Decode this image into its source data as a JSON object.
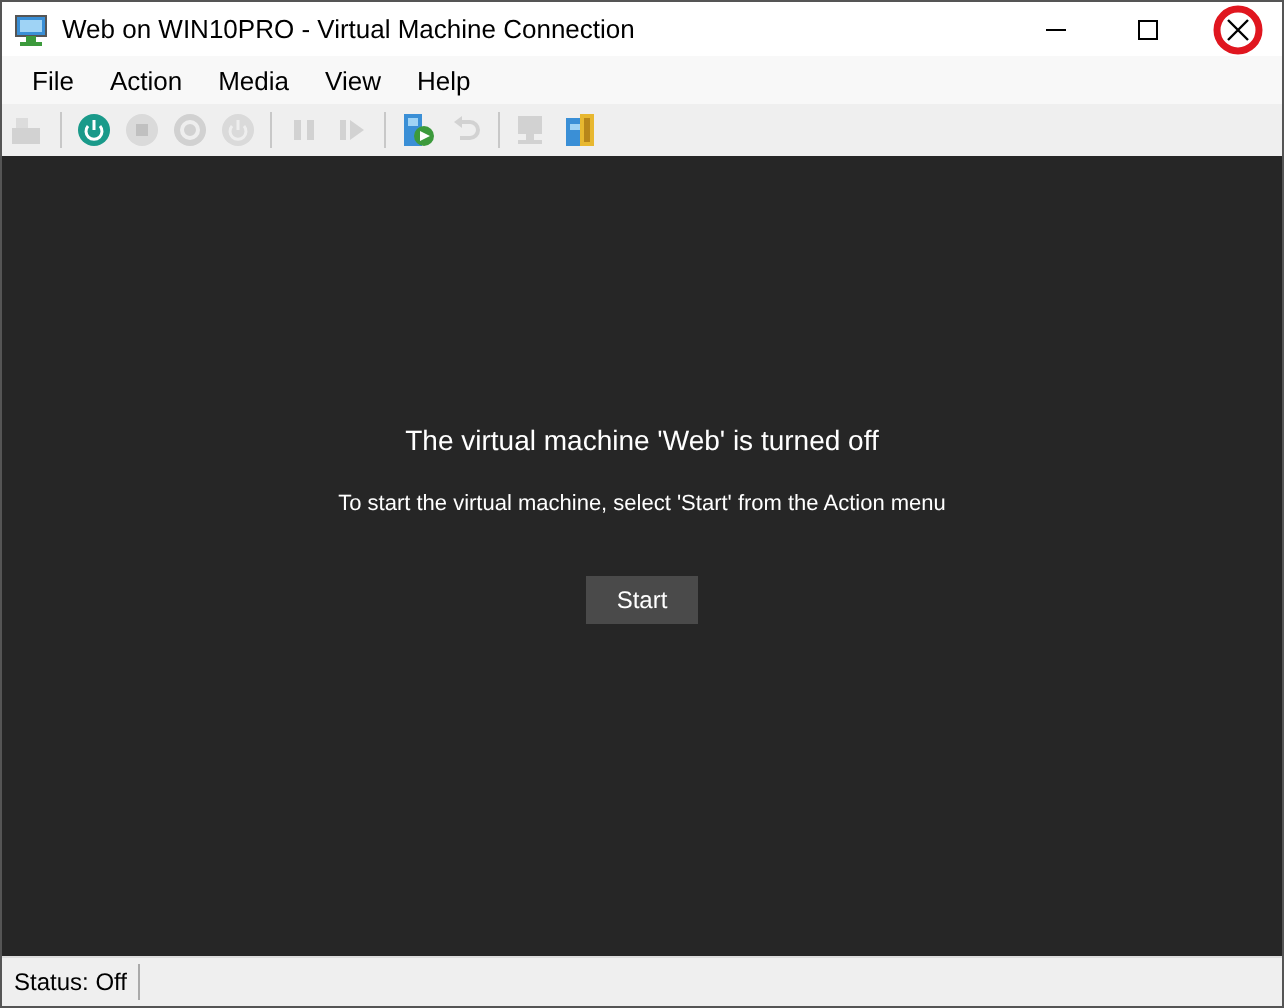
{
  "window": {
    "title": "Web on WIN10PRO - Virtual Machine Connection"
  },
  "menu": [
    "File",
    "Action",
    "Media",
    "View",
    "Help"
  ],
  "toolbar_groups": [
    [
      {
        "kind": "keyboard",
        "disabled": true
      }
    ],
    [
      {
        "kind": "start",
        "disabled": false
      },
      {
        "kind": "stop",
        "disabled": true
      },
      {
        "kind": "shutdown",
        "disabled": true
      },
      {
        "kind": "power",
        "disabled": true
      }
    ],
    [
      {
        "kind": "pause",
        "disabled": true
      },
      {
        "kind": "resume",
        "disabled": true
      }
    ],
    [
      {
        "kind": "checkpoint",
        "disabled": false
      },
      {
        "kind": "revert",
        "disabled": true
      }
    ],
    [
      {
        "kind": "session",
        "disabled": true
      },
      {
        "kind": "share",
        "disabled": false
      }
    ]
  ],
  "screen": {
    "heading": "The virtual machine 'Web' is turned off",
    "hint": "To start the virtual machine, select 'Start' from the Action menu",
    "button": "Start"
  },
  "status_bar": "Status: Off"
}
